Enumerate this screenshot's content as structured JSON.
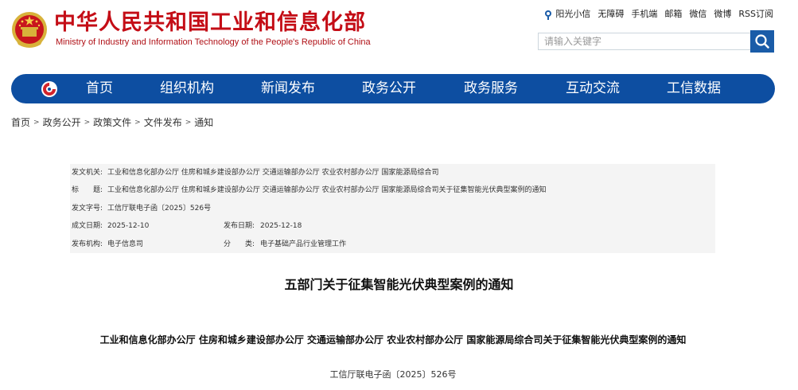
{
  "header": {
    "title": "中华人民共和国工业和信息化部",
    "subtitle": "Ministry of Industry and Information Technology of the People's Republic of China",
    "top_links": [
      "阳光小信",
      "无障碍",
      "手机端",
      "邮箱",
      "微信",
      "微博",
      "RSS订阅"
    ]
  },
  "search": {
    "placeholder": "请输入关键字"
  },
  "nav": {
    "items": [
      "首页",
      "组织机构",
      "新闻发布",
      "政务公开",
      "政务服务",
      "互动交流",
      "工信数据"
    ]
  },
  "breadcrumb": [
    "首页",
    "政务公开",
    "政策文件",
    "文件发布",
    "通知"
  ],
  "meta": {
    "issuer_label": "发文机关:",
    "issuer": "工业和信息化部办公厅 住房和城乡建设部办公厅 交通运输部办公厅 农业农村部办公厅 国家能源局综合司",
    "title_label": "标　　题:",
    "title": "工业和信息化部办公厅 住房和城乡建设部办公厅 交通运输部办公厅 农业农村部办公厅 国家能源局综合司关于征集智能光伏典型案例的通知",
    "doc_no_label": "发文字号:",
    "doc_no": "工信厅联电子函〔2025〕526号",
    "created_label": "成文日期:",
    "created": "2025-12-10",
    "published_label": "发布日期:",
    "published": "2025-12-18",
    "agency_label": "发布机构:",
    "agency": "电子信息司",
    "category_label": "分　　类:",
    "category": "电子基础产品行业管理工作"
  },
  "article": {
    "title": "五部门关于征集智能光伏典型案例的通知",
    "subtitle": "工业和信息化部办公厅  住房和城乡建设部办公厅  交通运输部办公厅  农业农村部办公厅  国家能源局综合司关于征集智能光伏典型案例的通知",
    "doc_number": "工信厅联电子函〔2025〕526号"
  },
  "colors": {
    "brand_red": "#c40d16",
    "nav_blue": "#0d4ea1",
    "search_blue": "#1a5ca8",
    "meta_bg": "#f4f4f4"
  }
}
